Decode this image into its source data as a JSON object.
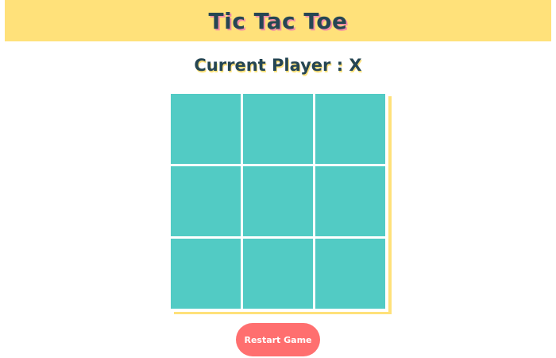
{
  "header": {
    "title": "Tic Tac Toe"
  },
  "status": {
    "text": "Current Player : X"
  },
  "board": {
    "cells": [
      "",
      "",
      "",
      "",
      "",
      "",
      "",
      "",
      ""
    ]
  },
  "controls": {
    "restart_label": "Restart Game"
  },
  "colors": {
    "header_bg": "#ffe17a",
    "cell_bg": "#52cbc4",
    "text_dark": "#264653",
    "title_shadow": "#f48fa6",
    "button_bg": "#ff6f6f"
  }
}
